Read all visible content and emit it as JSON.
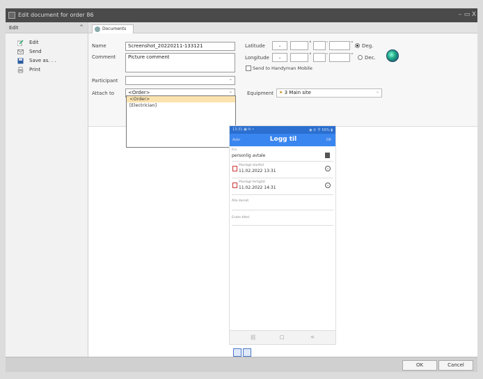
{
  "window": {
    "title": "Edit document for order 86",
    "minimize": "–",
    "maximize": "▭",
    "close": "X"
  },
  "sidebar": {
    "header": "Edit",
    "collapse_glyph": "^",
    "items": [
      {
        "label": "Edit"
      },
      {
        "label": "Send"
      },
      {
        "label": "Save as. . ."
      },
      {
        "label": "Print"
      }
    ]
  },
  "tabs": [
    {
      "label": "Documents"
    }
  ],
  "form": {
    "name_label": "Name",
    "name_value": "Screenshot_20220211-133121",
    "comment_label": "Comment",
    "comment_value": "Picture comment",
    "participant_label": "Participant",
    "participant_value": "",
    "attach_label": "Attach to",
    "attach_value": "<Order>",
    "attach_options": [
      "<Order>",
      "[Electrician]"
    ],
    "latitude_label": "Latitude",
    "longitude_label": "Longitude",
    "deg_label": "Deg.",
    "dec_label": "Dec.",
    "send_label": "Send to Handyman Mobile",
    "equipment_label": "Equipment",
    "equipment_value": "3 Main site",
    "degree_symbol": "°",
    "minute_symbol": "'",
    "second_symbol": "\"",
    "dropdown_glyph": "⌄"
  },
  "phone": {
    "status_left": "13:31 ▣ ✉ •",
    "status_right": "◉ ✆ 㐃 56% ▮",
    "back": "Avbr",
    "title": "Logg til",
    "ok": "OK",
    "from_label": "Fra",
    "from_value": "personlig avtale",
    "start_label": "Planlagt starttid",
    "start_value": "11.02.2022 13:31",
    "end_label": "Planlagt fertigtid",
    "end_value": "11.02.2022 14:31",
    "field3": "Alla dorset",
    "field4": "Endre tittel",
    "nav": [
      "|||",
      "□",
      "<"
    ],
    "circle_glyph": "⌄"
  },
  "footer": {
    "ok": "OK",
    "cancel": "Cancel"
  }
}
